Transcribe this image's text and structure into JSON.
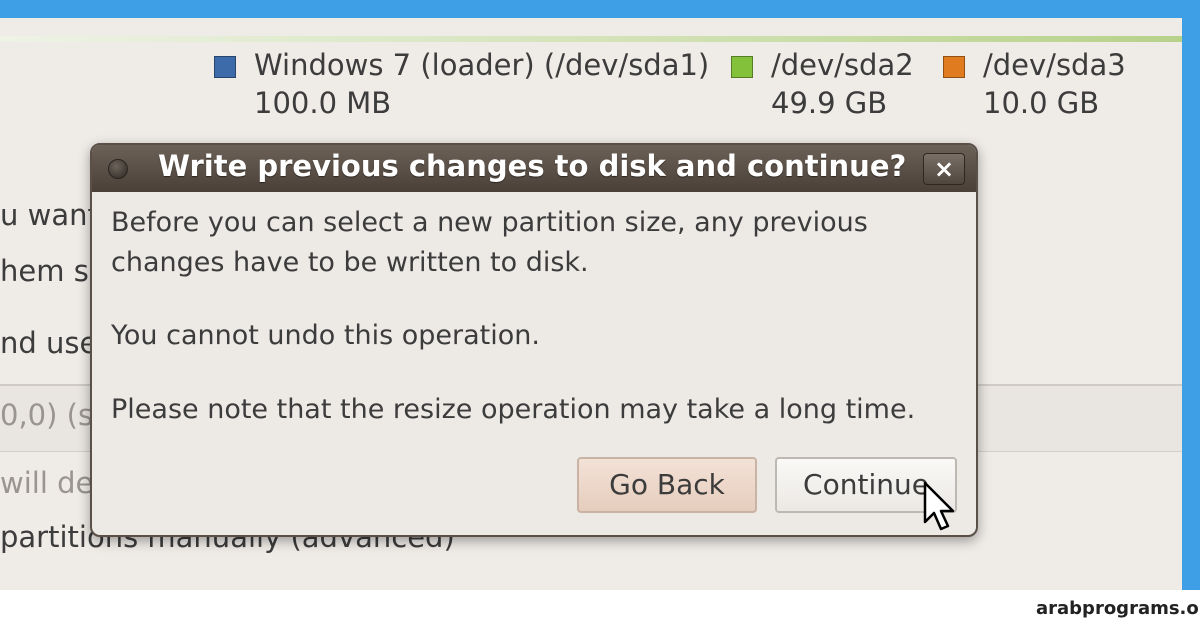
{
  "legend": [
    {
      "name": "Windows 7 (loader) (/dev/sda1)",
      "size": "100.0 MB",
      "color": "#3d6aa8"
    },
    {
      "name": "/dev/sda2",
      "size": "49.9 GB",
      "color": "#84c13a"
    },
    {
      "name": "/dev/sda3",
      "size": "10.0 GB",
      "color": "#e07b1f"
    }
  ],
  "background_lines": [
    "u want",
    "hem si",
    "nd use",
    "0,0) (s",
    "will de",
    "partitions manually (advanced)"
  ],
  "dialog": {
    "title": "Write previous changes to disk and continue?",
    "close_label": "×",
    "message_line1": "Before you can select a new partition size, any previous",
    "message_line2": "changes have to be written to disk.",
    "message_line3": "You cannot undo this operation.",
    "message_line4": "Please note that the resize operation may take a long time.",
    "go_back_label": "Go Back",
    "continue_label": "Continue"
  },
  "watermark": "arabprograms.org",
  "colors": {
    "frame": "#3f9fe6",
    "titlebar": "#4a4038",
    "go_back_button": "#e6cdbd"
  }
}
